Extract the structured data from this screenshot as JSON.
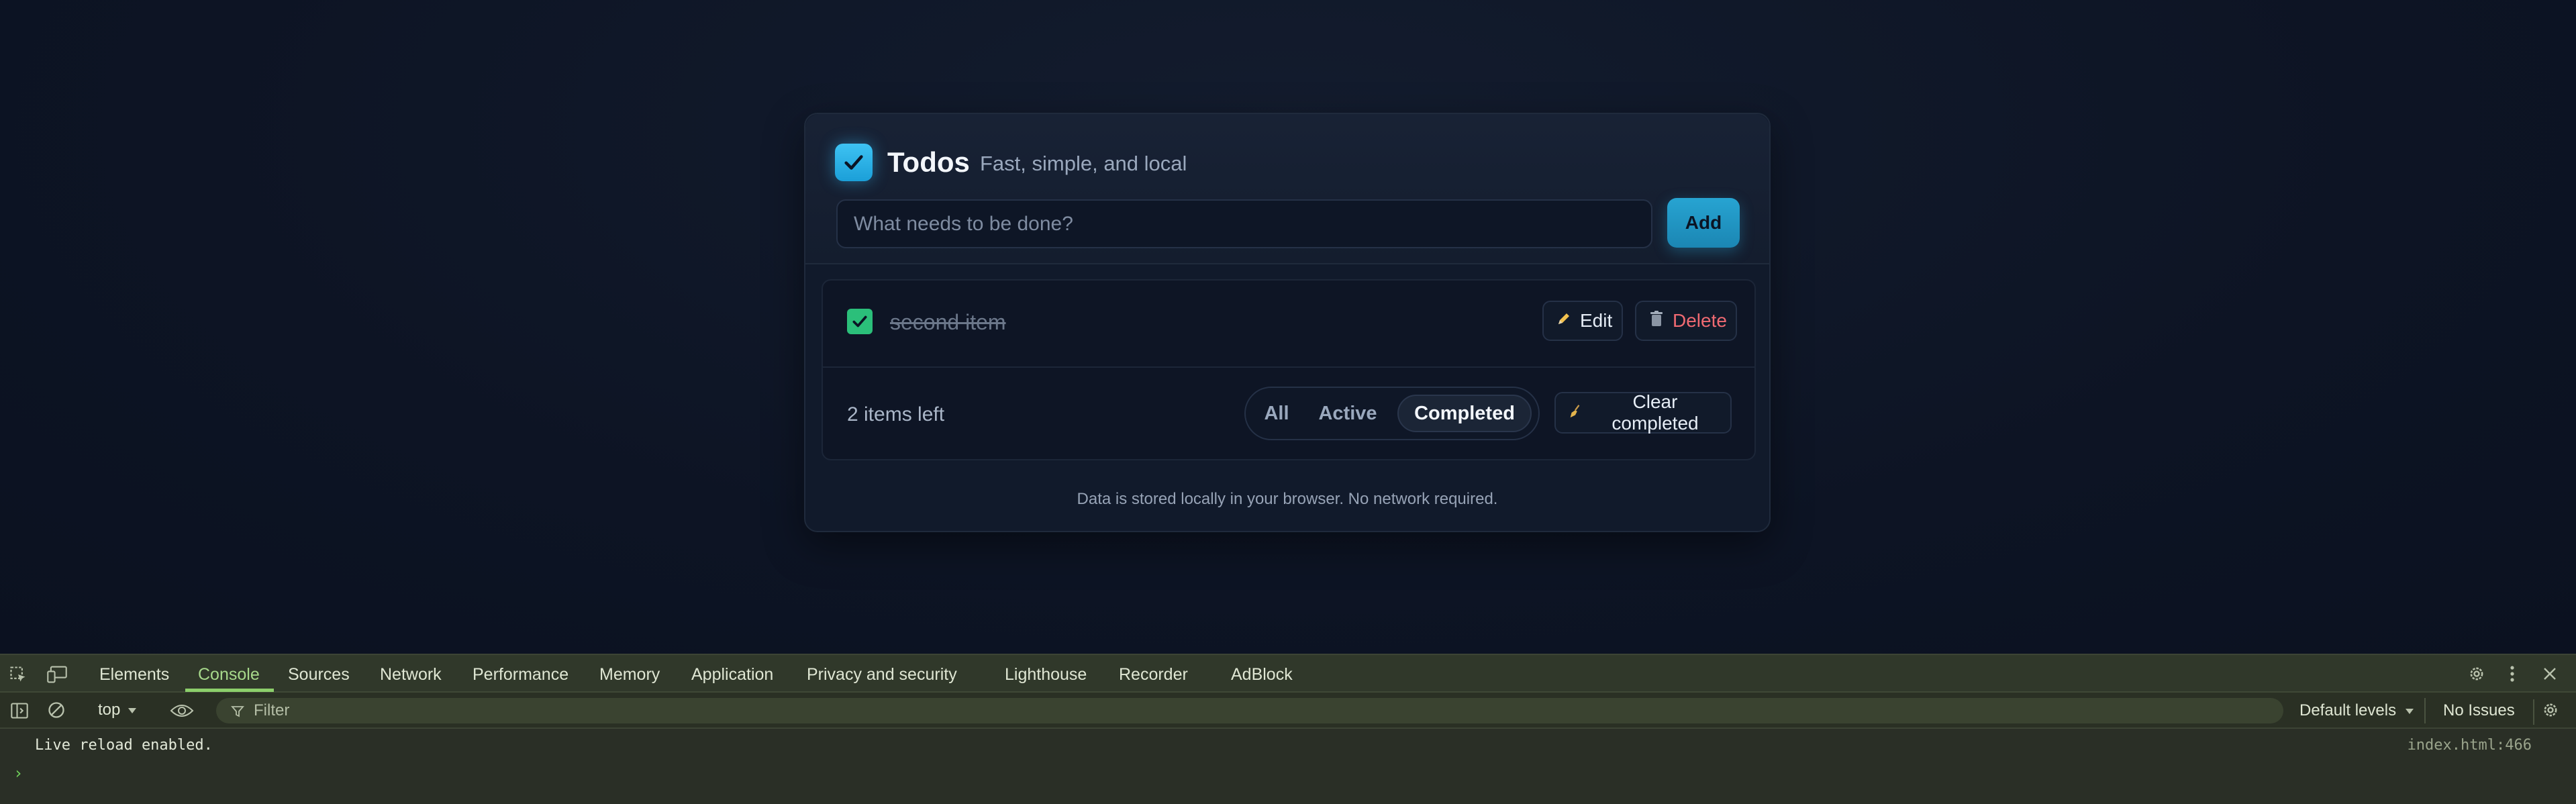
{
  "app": {
    "title": "Todos",
    "subtitle": "Fast, simple, and local",
    "input": {
      "placeholder": "What needs to be done?",
      "value": ""
    },
    "add_label": "Add",
    "todos": [
      {
        "text": "second item",
        "completed": true,
        "edit_label": "Edit",
        "delete_label": "Delete"
      }
    ],
    "items_left": "2 items left",
    "filters": [
      "All",
      "Active",
      "Completed"
    ],
    "active_filter": "Completed",
    "clear_label": "Clear completed",
    "note": "Data is stored locally in your browser. No network required.",
    "colors": {
      "accent": "#27a4d2",
      "check": "#2bbf7a",
      "danger": "#f06a72"
    }
  },
  "devtools": {
    "tabs": [
      "Elements",
      "Console",
      "Sources",
      "Network",
      "Performance",
      "Memory",
      "Application",
      "Privacy and security",
      "Lighthouse",
      "Recorder",
      "AdBlock"
    ],
    "active_tab": "Console",
    "context": "top",
    "filter_placeholder": "Filter",
    "levels": "Default levels",
    "issues": "No Issues",
    "console": {
      "message": "Live reload enabled.",
      "source": "index.html:466",
      "prompt": "›"
    },
    "icons": [
      "inspect-icon",
      "device-toolbar-icon",
      "settings-icon",
      "more-vertical-icon",
      "close-icon",
      "sidebar-icon",
      "clear-console-icon",
      "eye-icon",
      "filter-icon"
    ]
  }
}
